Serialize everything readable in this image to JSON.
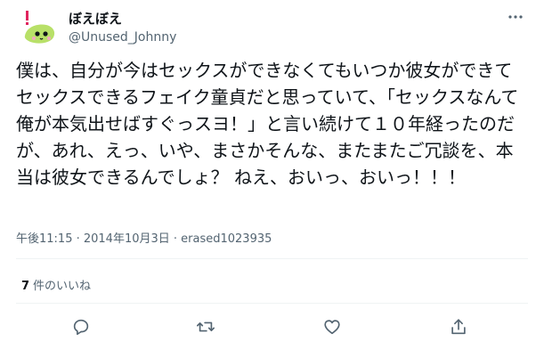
{
  "tweet": {
    "author_name": "ぼえぼえ",
    "author_handle": "@Unused_Johnny",
    "text": "僕は、自分が今はセックスができなくてもいつか彼女ができてセックスできるフェイク童貞だと思っていて、「セックスなんて俺が本気出せばすぐっスヨ！」と言い続けて１０年経ったのだが、あれ、えっ、いや、まさかそんな、またまたご冗談を、本当は彼女できるんでしょ？ ねえ、おいっ、おいっ！！！",
    "timestamp_line": "午後11:15 · 2014年10月3日 · erased1023935",
    "like_count": "7",
    "like_label": "件のいいね"
  },
  "icons": {
    "more": "more-horizontal-icon",
    "reply": "reply-icon",
    "retweet": "retweet-icon",
    "like": "heart-icon",
    "share": "share-icon"
  },
  "colors": {
    "text": "#0f1419",
    "secondary": "#536471",
    "divider": "#eff3f4",
    "avatar_green": "#b8e068",
    "avatar_pink": "#f2a7c0",
    "avatar_red": "#e0245e"
  }
}
